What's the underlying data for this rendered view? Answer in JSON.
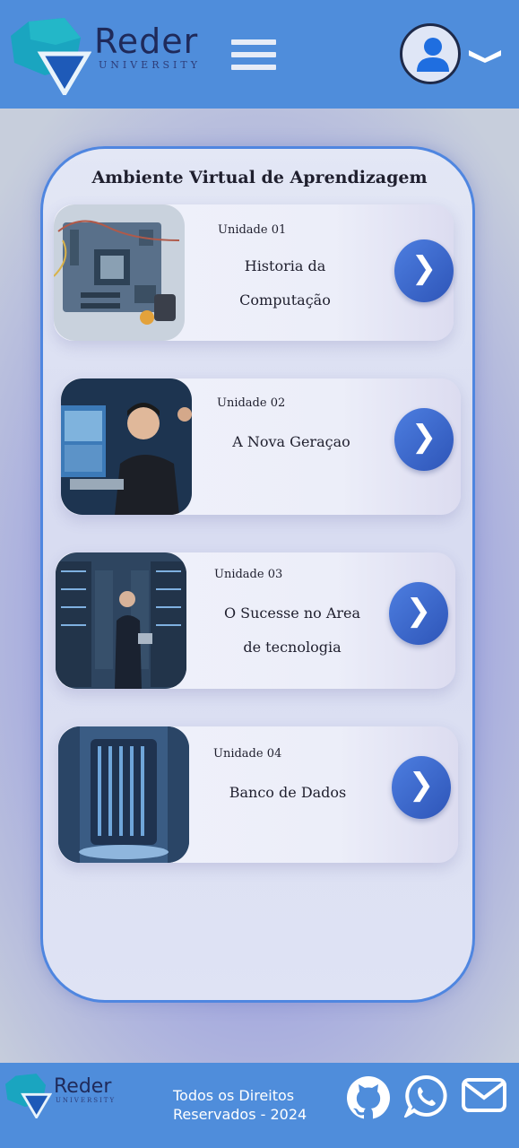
{
  "header": {
    "brand_name": "Reder",
    "brand_sub": "UNIVERSITY"
  },
  "panel": {
    "title": "Ambiente Virtual de Aprendizagem"
  },
  "units": [
    {
      "unit": "Unidade 01",
      "title_line1": "Historia da",
      "title_line2": "Computação",
      "image": "circuit-board-image"
    },
    {
      "unit": "Unidade 02",
      "title_line1": "A Nova Geraçao",
      "title_line2": "",
      "image": "student-computer-image"
    },
    {
      "unit": "Unidade 03",
      "title_line1": "O Sucesse no Area",
      "title_line2": "de tecnologia",
      "image": "datacenter-woman-image"
    },
    {
      "unit": "Unidade 04",
      "title_line1": "Banco de Dados",
      "title_line2": "",
      "image": "server-tower-image"
    }
  ],
  "footer": {
    "brand_name": "Reder",
    "brand_sub": "UNIVERSITY",
    "rights_line1": "Todos os Direitos",
    "rights_line2": "Reservados - 2024"
  },
  "icons": {
    "menu": "hamburger-menu-icon",
    "user": "user-icon",
    "dropdown": "chevron-down-icon",
    "next": "chevron-right-icon",
    "github": "github-icon",
    "whatsapp": "whatsapp-icon",
    "email": "mail-icon"
  },
  "colors": {
    "header_bg": "#4f8ddb",
    "button_gradient_start": "#4d7ee0",
    "button_gradient_end": "#2e55b8",
    "panel_border": "#4f86e0"
  }
}
